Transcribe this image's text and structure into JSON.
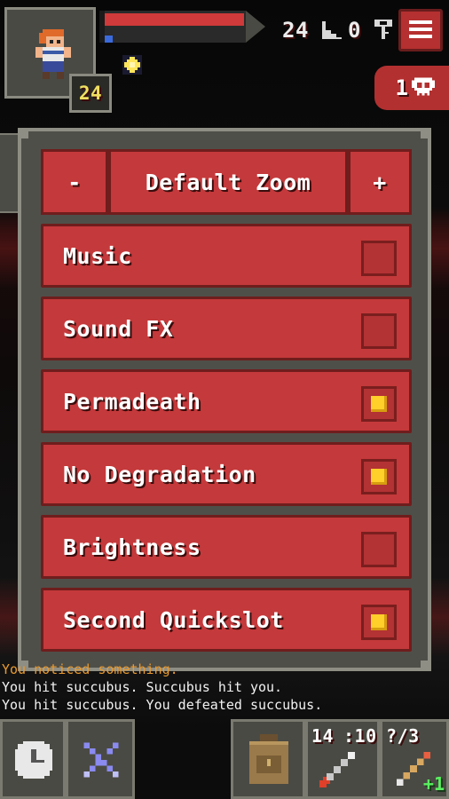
{
  "hud": {
    "level": "24",
    "hp_fraction": 0.99,
    "xp_fraction": 0.09,
    "depth": "24",
    "keys": "0",
    "danger_count": "1"
  },
  "settings": {
    "zoom_minus": "-",
    "zoom_label": "Default Zoom",
    "zoom_plus": "+",
    "options": [
      {
        "label": "Music",
        "checked": false
      },
      {
        "label": "Sound FX",
        "checked": false
      },
      {
        "label": "Permadeath",
        "checked": true
      },
      {
        "label": "No Degradation",
        "checked": true
      },
      {
        "label": "Brightness",
        "checked": false
      },
      {
        "label": "Second Quickslot",
        "checked": true
      }
    ]
  },
  "log": [
    "You noticed something.",
    "You hit succubus. Succubus hit you.",
    "You hit succubus. You defeated succubus."
  ],
  "toolbar": {
    "darts_count": "14",
    "darts_extra": ":10",
    "wand_charges": "?/3",
    "wand_level": "+1"
  },
  "colors": {
    "button_red": "#c4393b",
    "checkbox_on": "#ffd02a",
    "log_notice": "#e89a30"
  }
}
